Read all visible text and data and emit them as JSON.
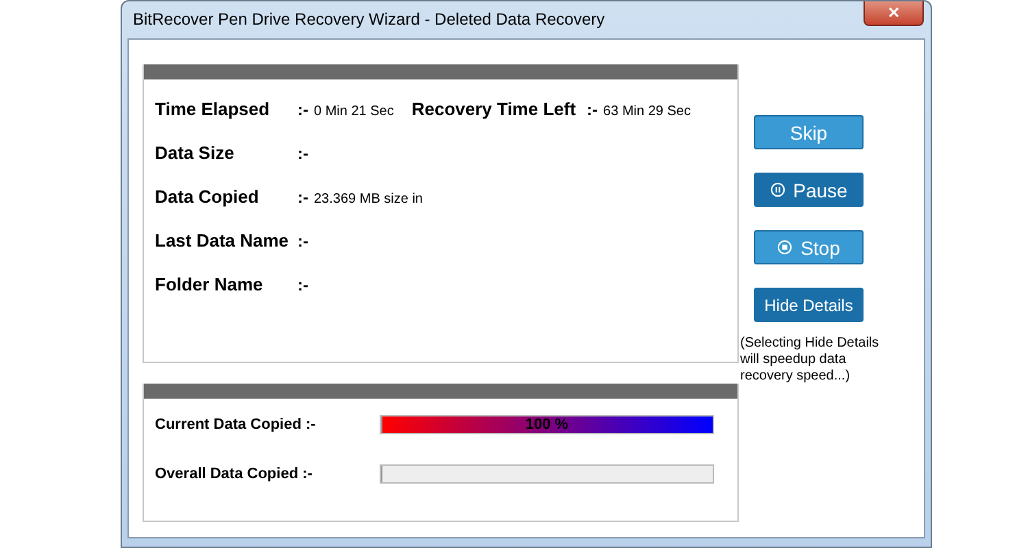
{
  "window": {
    "title": "BitRecover Pen Drive Recovery Wizard - Deleted Data Recovery",
    "close_label": "✕"
  },
  "details": {
    "rows": [
      [
        {
          "label": "Time Elapsed",
          "separator": ":-",
          "value": "0 Min 21 Sec"
        },
        {
          "label": "Recovery Time Left",
          "separator": ":-",
          "value": "63 Min 29 Sec"
        }
      ],
      [
        {
          "label": "Data Size",
          "separator": ":-"
        }
      ],
      [
        {
          "label": "Data Copied",
          "separator": ":-",
          "value": "23.369 MB size in"
        }
      ],
      [
        {
          "label": "Last Data Name",
          "separator": ":-"
        }
      ],
      [
        {
          "label": "Folder Name",
          "separator": ":-"
        }
      ]
    ]
  },
  "progress": [
    {
      "label": "Current Data Copied :-",
      "level": 1,
      "text": "100 %"
    },
    {
      "label": "Overall Data Copied :-",
      "level": 0
    }
  ],
  "buttons": [
    {
      "label": "Skip",
      "kind": "plain",
      "emphasized": false
    },
    {
      "label": "Pause",
      "kind": "pause",
      "emphasized": true
    },
    {
      "label": "Stop",
      "kind": "stop",
      "emphasized": false
    },
    {
      "label": "Hide Details",
      "kind": "plain",
      "emphasized": true
    }
  ],
  "note": "(Selecting Hide Details will speedup data recovery speed...)"
}
